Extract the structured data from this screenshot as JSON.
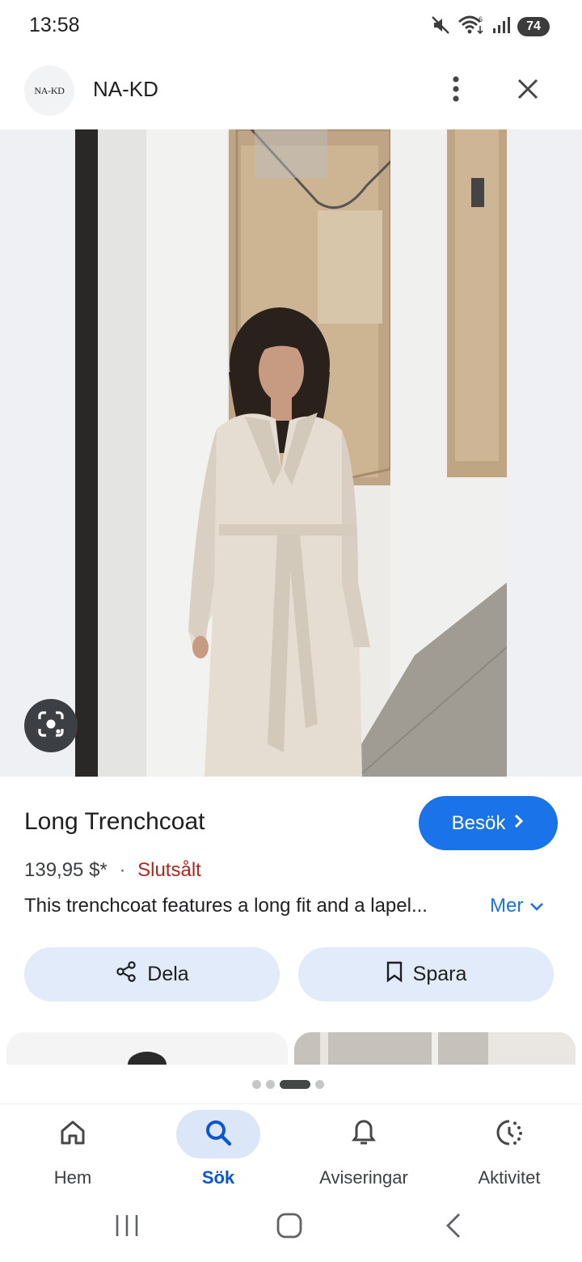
{
  "status_bar": {
    "time": "13:58",
    "battery": "74",
    "icons": [
      "mute-icon",
      "wifi-icon",
      "signal-icon",
      "battery-icon"
    ]
  },
  "header": {
    "logo_text": "NA-KD",
    "source_name": "NA-KD",
    "icons": [
      "more-vert-icon",
      "close-icon"
    ]
  },
  "product": {
    "title": "Long Trenchcoat",
    "price": "139,95 $*",
    "separator": "·",
    "stock_status": "Slutsålt",
    "description": "This trenchcoat features a long fit and a lapel...",
    "more_label": "Mer",
    "visit_label": "Besök",
    "share_label": "Dela",
    "save_label": "Spara"
  },
  "pager": {
    "count": 4,
    "active_index": 2
  },
  "bottom_nav": {
    "items": [
      {
        "label": "Hem",
        "icon": "home-icon",
        "active": false
      },
      {
        "label": "Sök",
        "icon": "search-icon",
        "active": true
      },
      {
        "label": "Aviseringar",
        "icon": "bell-icon",
        "active": false
      },
      {
        "label": "Aktivitet",
        "icon": "activity-icon",
        "active": false
      }
    ]
  },
  "colors": {
    "accent": "#1a73e8",
    "sold_out": "#b3261e",
    "pill_bg": "#e2ebfa",
    "active_nav_bg": "#dce6f9"
  }
}
